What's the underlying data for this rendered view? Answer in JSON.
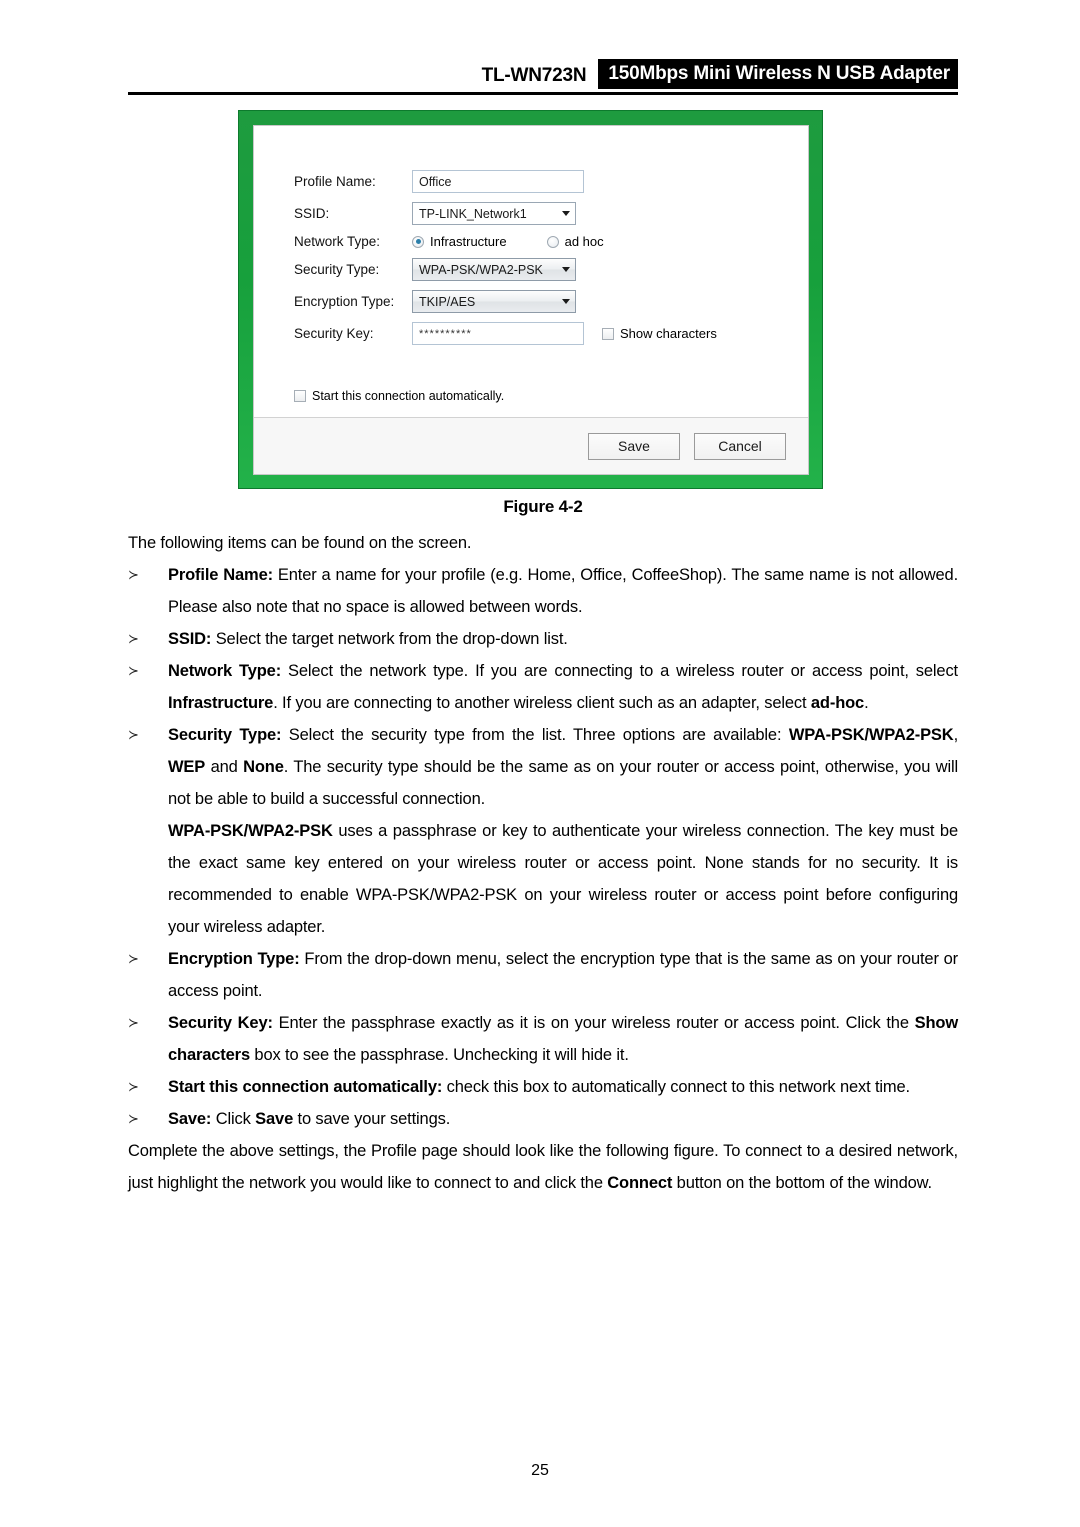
{
  "header": {
    "model": "TL-WN723N",
    "product": "150Mbps Mini Wireless N USB Adapter"
  },
  "figure": {
    "caption": "Figure 4-2",
    "dialog": {
      "labels": {
        "profile_name": "Profile Name:",
        "ssid": "SSID:",
        "network_type": "Network Type:",
        "security_type": "Security Type:",
        "encryption_type": "Encryption Type:",
        "security_key": "Security Key:"
      },
      "values": {
        "profile_name": "Office",
        "ssid": "TP-LINK_Network1",
        "security_type": "WPA-PSK/WPA2-PSK",
        "encryption_type": "TKIP/AES",
        "security_key": "**********"
      },
      "network_type_options": [
        {
          "label": "Infrastructure",
          "selected": true
        },
        {
          "label": "ad hoc",
          "selected": false
        }
      ],
      "show_characters_label": "Show characters",
      "auto_start_label": "Start this connection automatically.",
      "buttons": {
        "save": "Save",
        "cancel": "Cancel"
      }
    }
  },
  "body": {
    "intro": "The following items can be found on the screen.",
    "bullet_mark": "≻",
    "items": [
      {
        "term": "Profile Name:",
        "text": " Enter a name for your profile (e.g. Home, Office, CoffeeShop). The same name is not allowed. Please also note that no space is allowed between words."
      },
      {
        "term": "SSID:",
        "text": " Select the target network from the drop-down list."
      },
      {
        "term": "Network Type:",
        "text_part1": " Select the network type. If you are connecting to a wireless router or access point, select ",
        "bold1": "Infrastructure",
        "text_part2": ". If you are connecting to another wireless client such as an adapter, select ",
        "bold2": "ad-hoc",
        "text_part3": "."
      },
      {
        "term": "Security Type:",
        "text_part1": " Select the security type from the list. Three options are available: ",
        "bold1": "WPA-PSK/WPA2-PSK",
        "text_part2": ", ",
        "bold2": "WEP",
        "text_part3": " and ",
        "bold3": "None",
        "text_part4": ". The security type should be the same as on your router or access point, otherwise, you will not be able to build a successful connection."
      },
      {
        "term": "Encryption Type:",
        "text": " From the drop-down menu, select the encryption type that is the same as on your router or access point."
      },
      {
        "term": "Security Key:",
        "text_part1": " Enter the passphrase exactly as it is on your wireless router or access point. Click the ",
        "bold1": "Show characters",
        "text_part2": " box to see the passphrase. Unchecking it will hide it."
      },
      {
        "term": "Start this connection automatically:",
        "text": " check this box to automatically connect to this network next time."
      },
      {
        "term": "Save:",
        "text_part1": " Click ",
        "bold1": "Save",
        "text_part2": " to save your settings."
      }
    ],
    "wpa_paragraph": {
      "bold1": "WPA-PSK/WPA2-PSK",
      "text": " uses a passphrase or key to authenticate your wireless connection. The key must be the exact same key entered on your wireless router or access point. None stands for no security. It is recommended to enable WPA-PSK/WPA2-PSK on your wireless router or access point before configuring your wireless adapter."
    },
    "closing": {
      "text_part1": "Complete the above settings, the Profile page should look like the following figure. To connect to a desired network, just highlight the network you would like to connect to and click the ",
      "bold1": "Connect",
      "text_part2": " button on the bottom of the window."
    }
  },
  "footer": {
    "page_number": "25"
  }
}
